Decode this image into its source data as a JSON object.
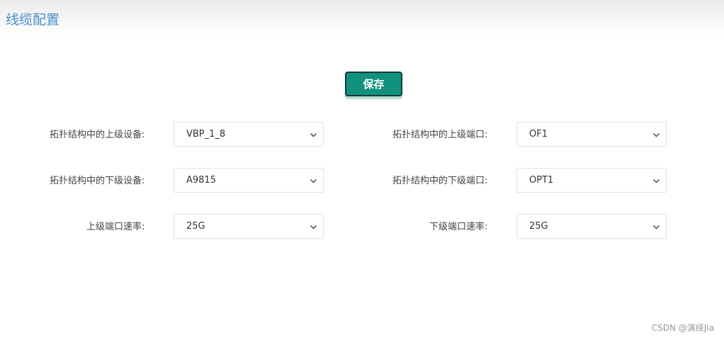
{
  "header": {
    "title": "线缆配置"
  },
  "toolbar": {
    "save_label": "保存"
  },
  "form": {
    "upper_device": {
      "label": "拓扑结构中的上级设备:",
      "value": "VBP_1_8"
    },
    "upper_port": {
      "label": "拓扑结构中的上级端口:",
      "value": "OF1"
    },
    "lower_device": {
      "label": "拓扑结构中的下级设备:",
      "value": "A9815"
    },
    "lower_port": {
      "label": "拓扑结构中的下级端口:",
      "value": "OPT1"
    },
    "upper_rate": {
      "label": "上级端口速率:",
      "value": "25G"
    },
    "lower_rate": {
      "label": "下级端口速率:",
      "value": "25G"
    }
  },
  "watermark": {
    "text": "CSDN @演绎Jia"
  },
  "colors": {
    "accent": "#12917f",
    "title": "#4a8fd1"
  },
  "icons": {
    "dropdown": "chevron-down-icon"
  }
}
